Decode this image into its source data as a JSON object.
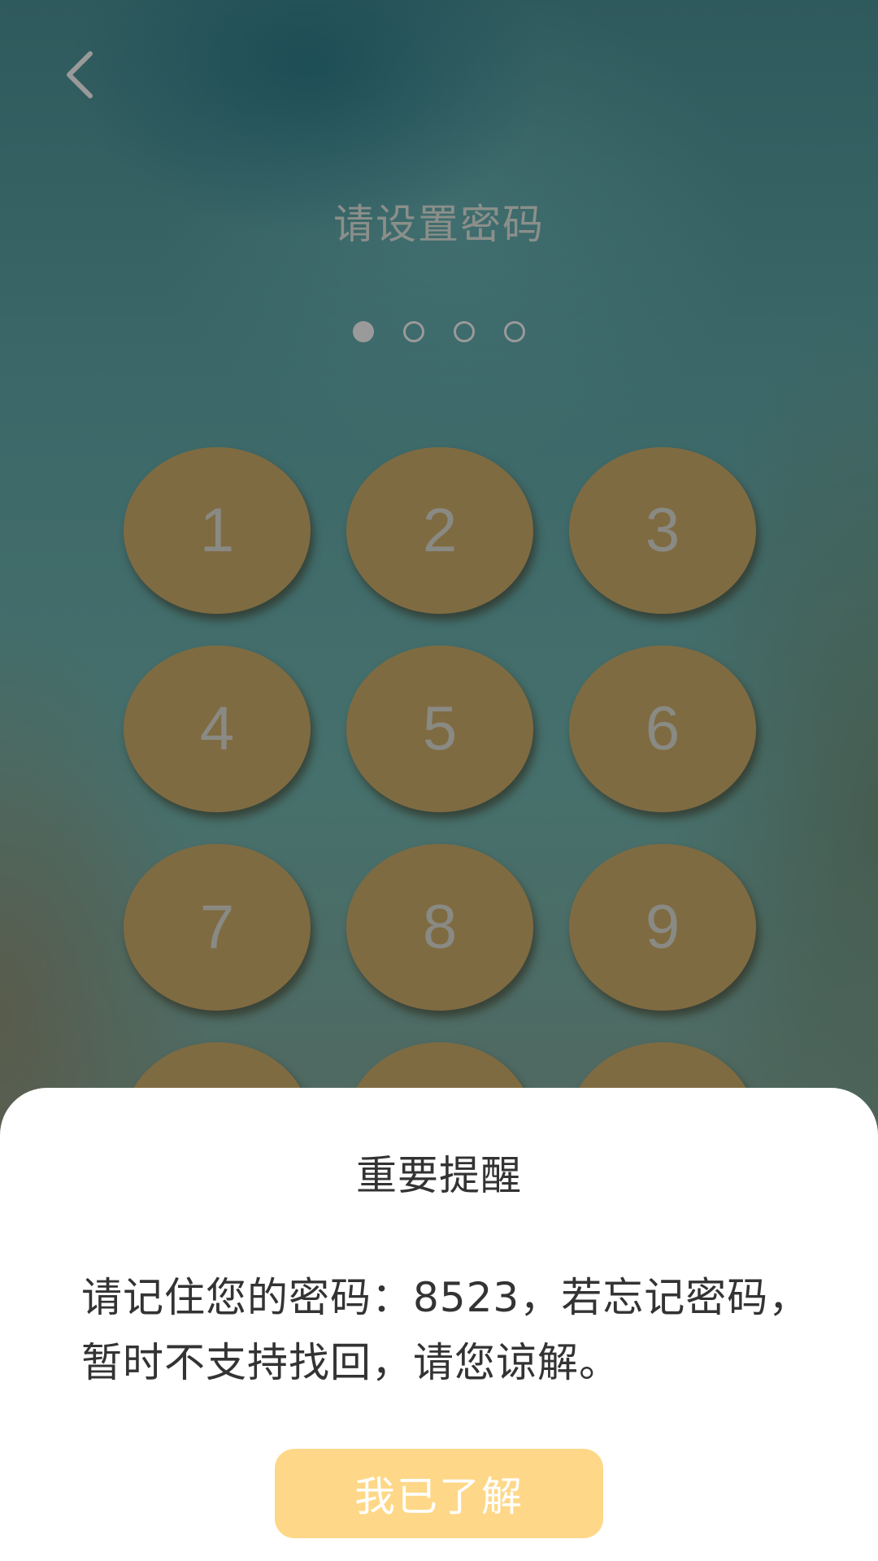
{
  "header": {
    "back_icon": "chevron-left-icon",
    "title": "请设置密码"
  },
  "pin_indicator": {
    "length": 4,
    "filled": 1
  },
  "keypad": {
    "keys": [
      "1",
      "2",
      "3",
      "4",
      "5",
      "6",
      "7",
      "8",
      "9",
      "",
      "",
      ""
    ]
  },
  "dialog": {
    "title": "重要提醒",
    "message": "请记住您的密码：8523，若忘记密码，暂时不支持找回，请您谅解。",
    "confirm_label": "我已了解"
  },
  "colors": {
    "key_fill": "#7f6b42",
    "key_text": "#8a8a84",
    "confirm_button": "#fed888",
    "dialog_background": "#ffffff"
  }
}
